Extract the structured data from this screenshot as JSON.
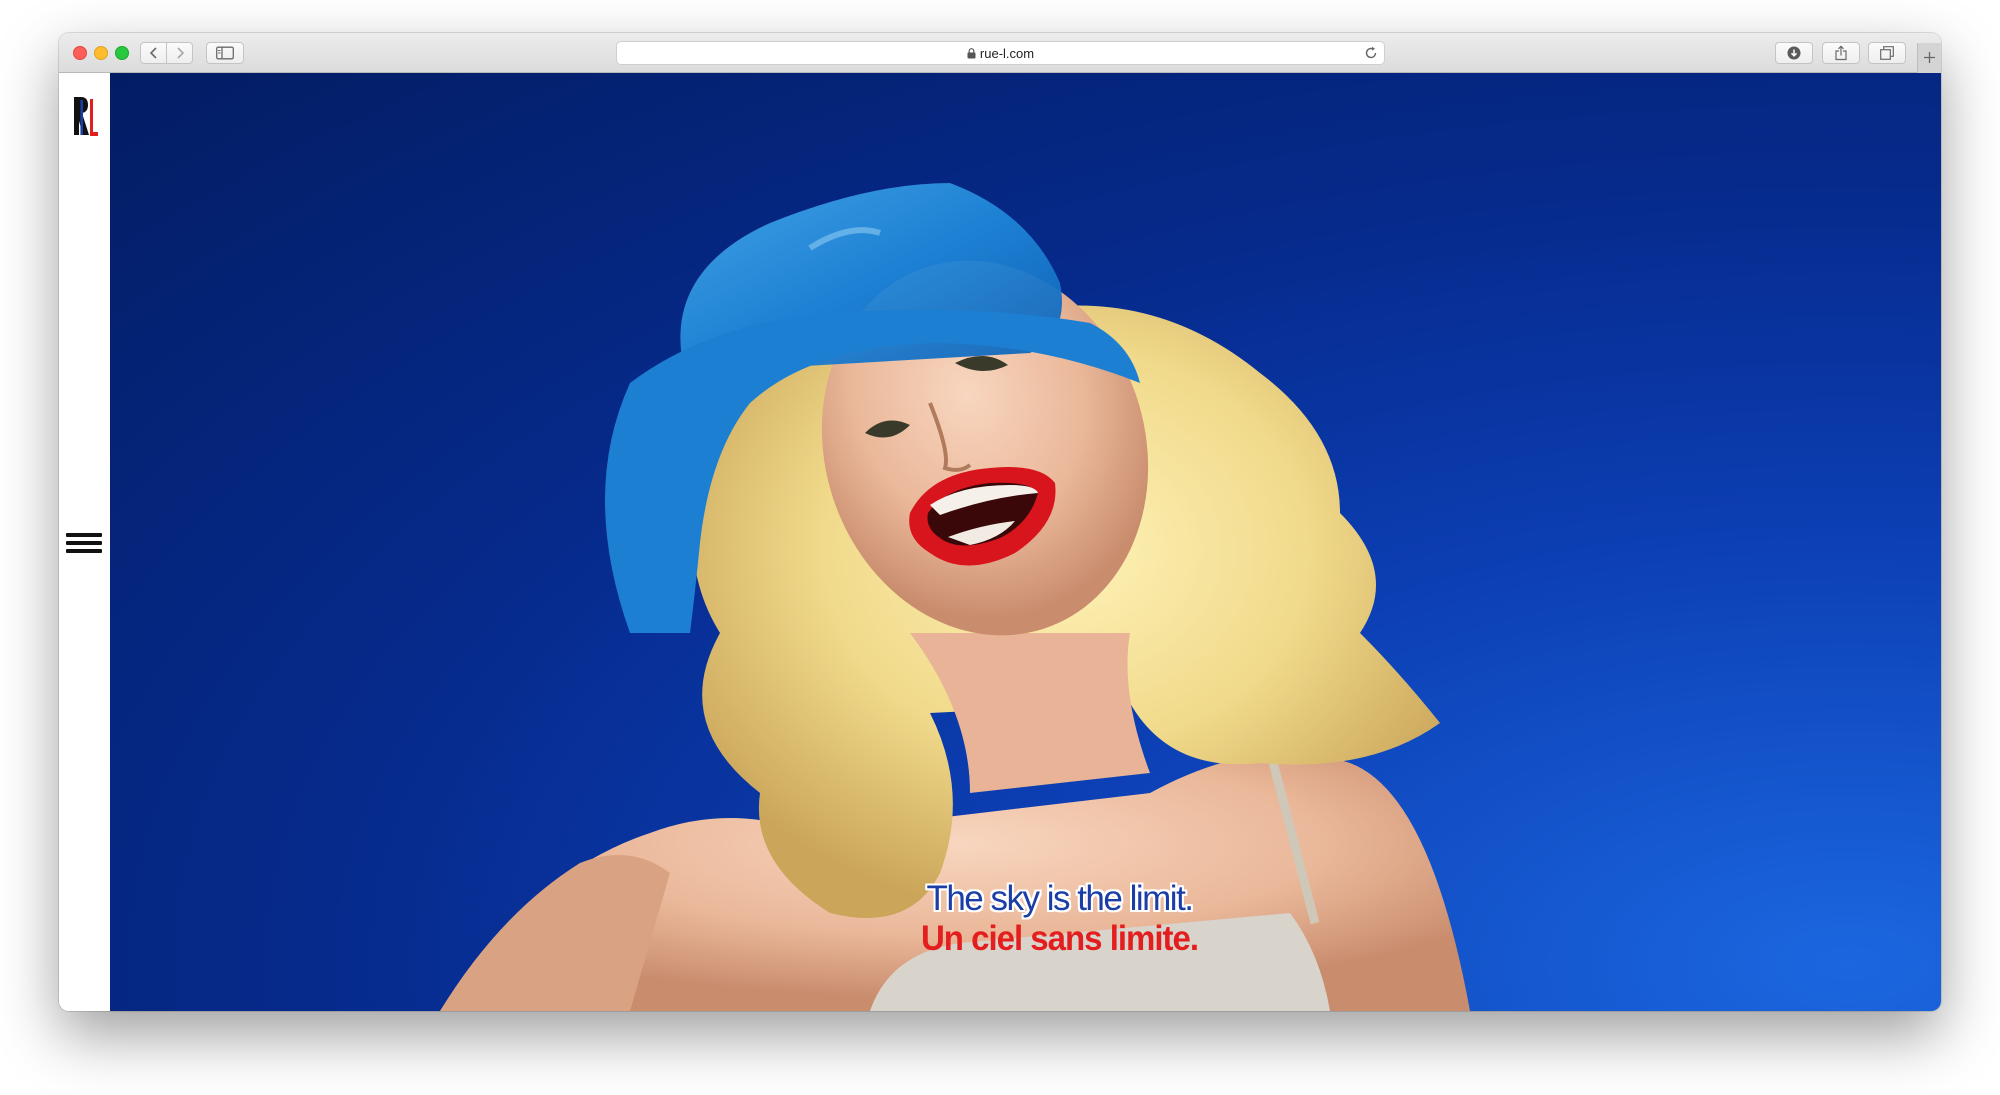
{
  "browser": {
    "url": "rue-l.com",
    "icons": {
      "back": "chevron-left-icon",
      "forward": "chevron-right-icon",
      "sidebar": "sidebar-icon",
      "lock": "lock-icon",
      "reload": "reload-icon",
      "downloads": "download-icon",
      "share": "share-icon",
      "tabs": "tabs-icon",
      "new_tab": "plus-icon"
    }
  },
  "site": {
    "logo": "RL",
    "menu_icon": "hamburger-menu-icon",
    "hero": {
      "tagline_en": "The sky is the limit.",
      "tagline_fr": "Un ciel sans limite."
    },
    "colors": {
      "sky_dark": "#031d63",
      "sky_light": "#1b67e0",
      "logo_red": "#e41e1e",
      "tagline_blue": "#1a3ea6",
      "tagline_red": "#e41e1e"
    }
  }
}
